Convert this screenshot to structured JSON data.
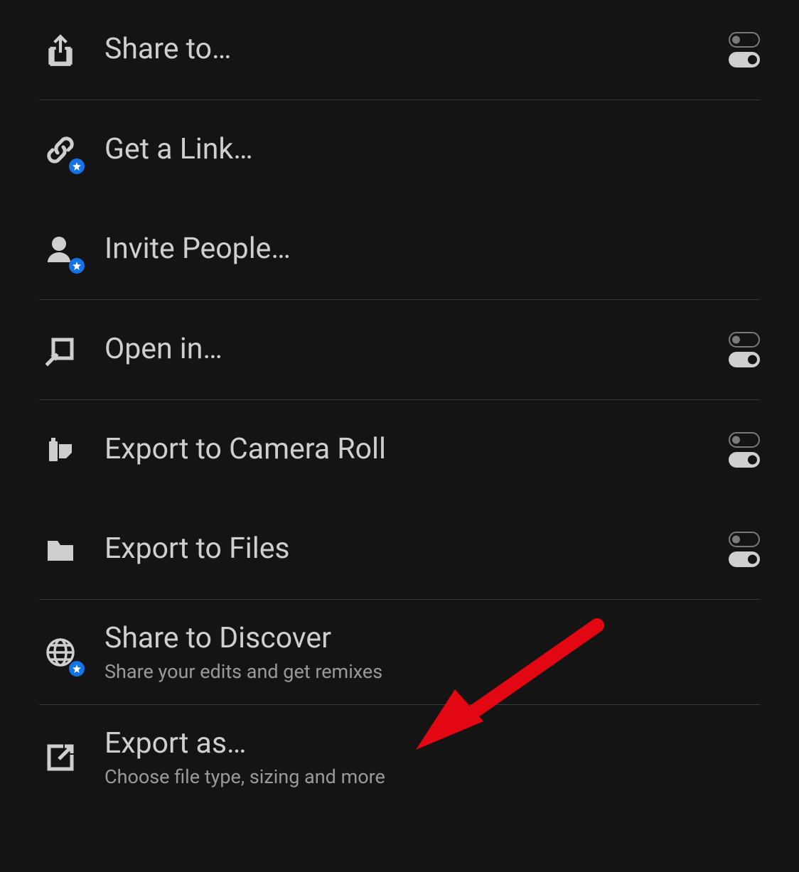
{
  "menu": {
    "items": [
      {
        "label": "Share to…",
        "hasToggle": true
      },
      {
        "label": "Get a Link…"
      },
      {
        "label": "Invite People…"
      },
      {
        "label": "Open in…",
        "hasToggle": true
      },
      {
        "label": "Export to Camera Roll",
        "hasToggle": true
      },
      {
        "label": "Export to Files",
        "hasToggle": true
      },
      {
        "label": "Share to Discover",
        "sublabel": "Share your edits and get remixes"
      },
      {
        "label": "Export as…",
        "sublabel": "Choose file type, sizing and more"
      }
    ]
  }
}
